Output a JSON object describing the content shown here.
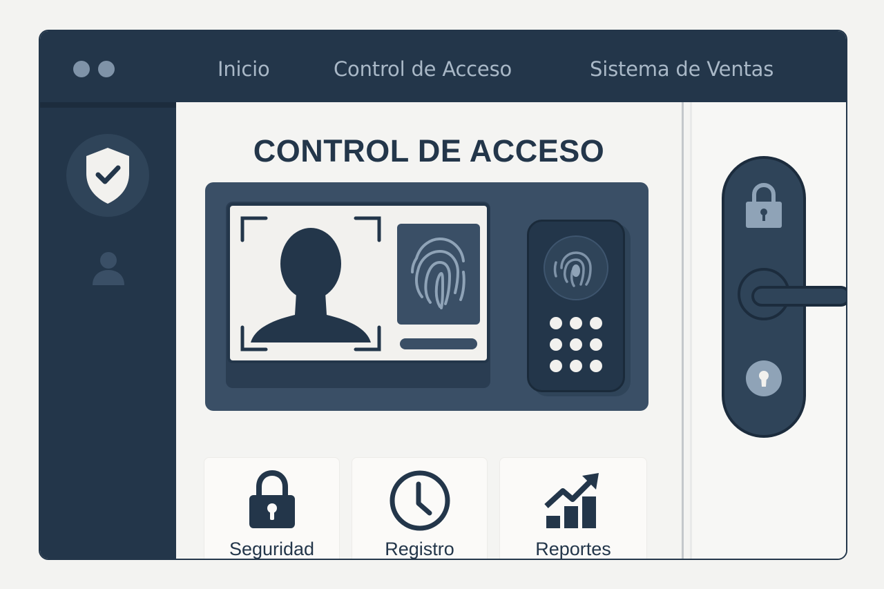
{
  "nav": {
    "items": [
      {
        "label": "Inicio"
      },
      {
        "label": "Control de Acceso"
      },
      {
        "label": "Sistema de Ventas"
      }
    ]
  },
  "main": {
    "title": "CONTROL DE ACCESO"
  },
  "tiles": [
    {
      "label": "Seguridad",
      "icon": "padlock-icon"
    },
    {
      "label": "Registro",
      "icon": "clock-icon"
    },
    {
      "label": "Reportes",
      "icon": "chart-up-icon"
    }
  ],
  "sidebar": {
    "icons": [
      "shield-check-icon",
      "user-icon"
    ]
  },
  "colors": {
    "dark_navy": "#23364a",
    "slate": "#3a4f66",
    "light_bg": "#f4f4f2",
    "accent_gray": "#7f93a8"
  }
}
